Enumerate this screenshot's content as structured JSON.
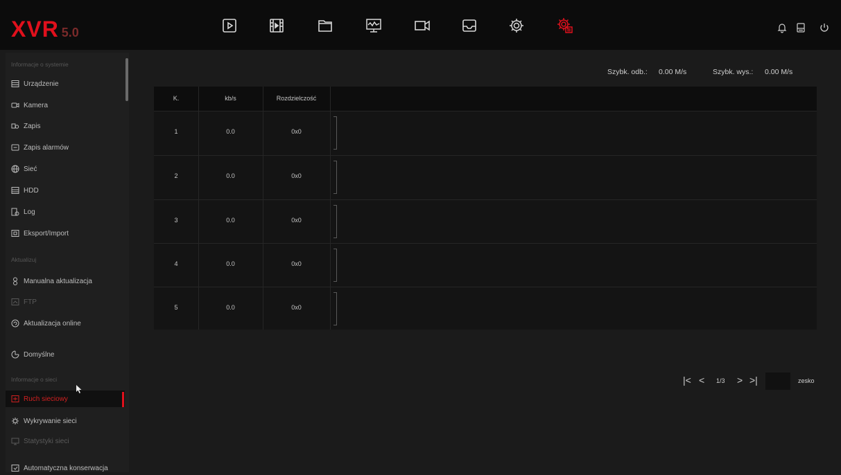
{
  "logo": {
    "brand": "XVR",
    "version": "5.0"
  },
  "topnav": {
    "icons": [
      "playback-icon",
      "video-clips-icon",
      "folder-icon",
      "monitor-chart-icon",
      "camera-icon",
      "inbox-icon",
      "settings-gear-icon",
      "system-maintenance-icon"
    ],
    "active": "system-maintenance-icon"
  },
  "topright": {
    "icons": [
      "bell-icon",
      "storage-icon",
      "power-icon"
    ]
  },
  "sidebar": {
    "section_system": "Informacje o systemie",
    "items_system": [
      "Urządzenie",
      "Kamera",
      "Zapis",
      "Zapis alarmów",
      "Sieć",
      "HDD",
      "Log",
      "Eksport/Import"
    ],
    "section_update": "Aktualizuj",
    "items_update": [
      "Manualna aktualizacja",
      "FTP",
      "Aktualizacja online"
    ],
    "default_item": "Domyślne",
    "section_network": "Informacje o sieci",
    "items_network": [
      "Ruch sieciowy",
      "Wykrywanie sieci",
      "Statystyki sieci"
    ],
    "maintenance_item": "Automatyczna konserwacja"
  },
  "speeds": {
    "download_label": "Szybk. odb.:",
    "download_value": "0.00 M/s",
    "upload_label": "Szybk. wys.:",
    "upload_value": "0.00 M/s"
  },
  "table": {
    "headers": [
      "K.",
      "kb/s",
      "Rozdzielczość"
    ],
    "rows": [
      [
        "1",
        "0.0",
        "0x0"
      ],
      [
        "2",
        "0.0",
        "0x0"
      ],
      [
        "3",
        "0.0",
        "0x0"
      ],
      [
        "4",
        "0.0",
        "0x0"
      ],
      [
        "5",
        "0.0",
        "0x0"
      ]
    ]
  },
  "pagination": {
    "page": "1/3",
    "goto_label": "zesko",
    "goto_value": ""
  },
  "colors": {
    "accent": "#e0101c",
    "background": "#1b1b1b"
  }
}
